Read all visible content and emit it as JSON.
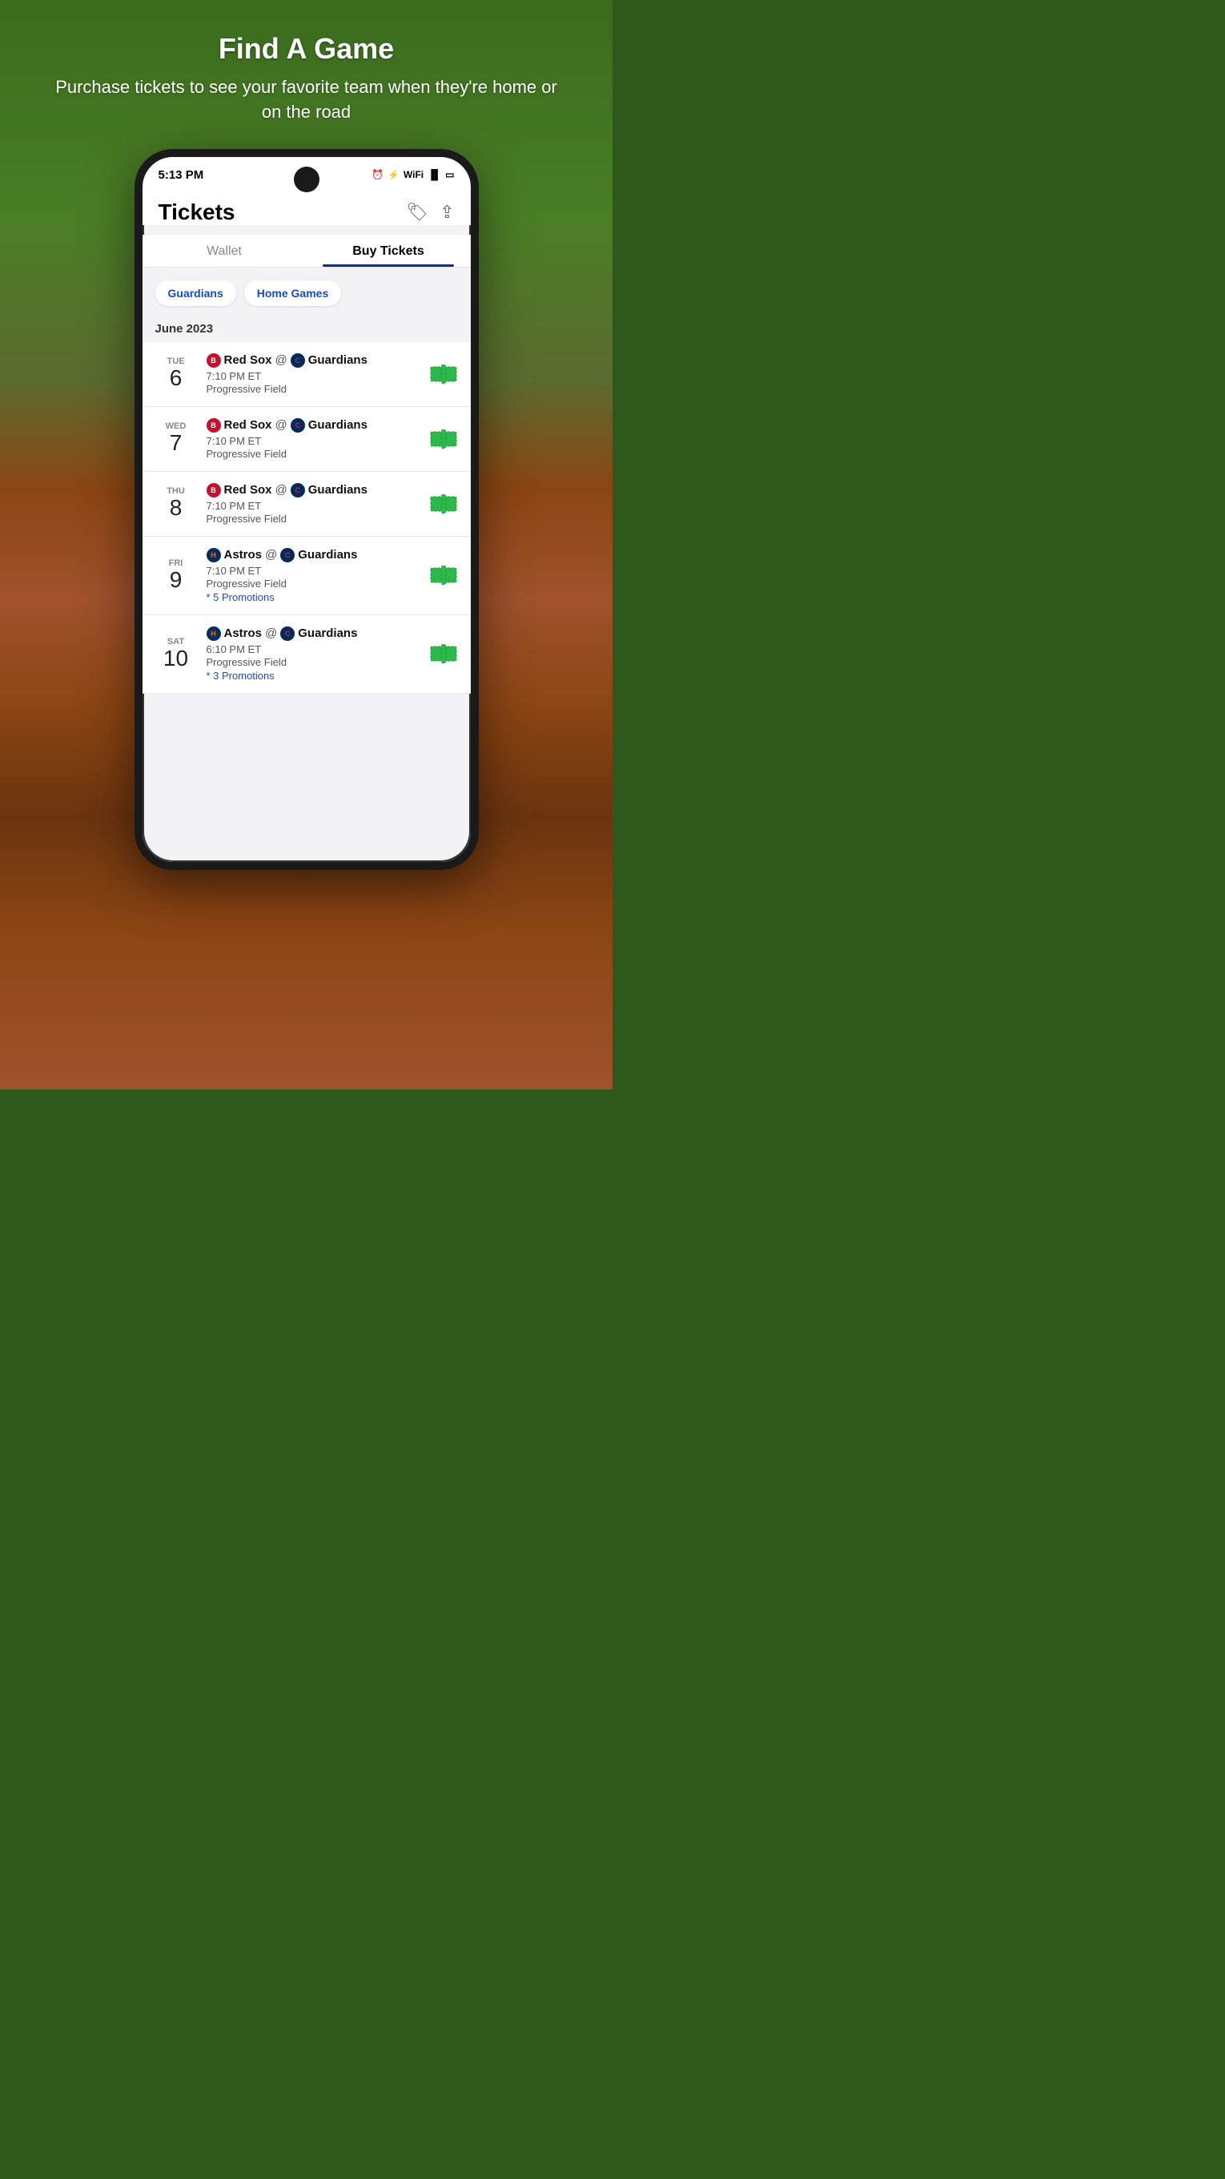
{
  "background": {
    "color": "#3a6b1e"
  },
  "hero": {
    "title": "Find A Game",
    "subtitle": "Purchase tickets to see your favorite team when they're home or on the road"
  },
  "status_bar": {
    "time": "5:13 PM"
  },
  "app": {
    "title": "Tickets",
    "header_icons": {
      "tags_icon": "🏷",
      "share_icon": "↗"
    },
    "tabs": [
      {
        "label": "Wallet",
        "active": false
      },
      {
        "label": "Buy Tickets",
        "active": true
      }
    ],
    "filters": [
      {
        "label": "Guardians"
      },
      {
        "label": "Home Games"
      }
    ],
    "month_section": {
      "label": "June 2023"
    },
    "games": [
      {
        "day_label": "TUE",
        "day_num": "6",
        "away_team": "Red Sox",
        "home_team": "Guardians",
        "time": "7:10 PM ET",
        "venue": "Progressive Field",
        "promotions": null,
        "away_abbr": "B",
        "home_abbr": "C",
        "away_type": "redsox",
        "home_type": "guardians"
      },
      {
        "day_label": "WED",
        "day_num": "7",
        "away_team": "Red Sox",
        "home_team": "Guardians",
        "time": "7:10 PM ET",
        "venue": "Progressive Field",
        "promotions": null,
        "away_abbr": "B",
        "home_abbr": "C",
        "away_type": "redsox",
        "home_type": "guardians"
      },
      {
        "day_label": "THU",
        "day_num": "8",
        "away_team": "Red Sox",
        "home_team": "Guardians",
        "time": "7:10 PM ET",
        "venue": "Progressive Field",
        "promotions": null,
        "away_abbr": "B",
        "home_abbr": "C",
        "away_type": "redsox",
        "home_type": "guardians"
      },
      {
        "day_label": "FRI",
        "day_num": "9",
        "away_team": "Astros",
        "home_team": "Guardians",
        "time": "7:10 PM ET",
        "venue": "Progressive Field",
        "promotions": "* 5 Promotions",
        "away_abbr": "H",
        "home_abbr": "C",
        "away_type": "astros",
        "home_type": "guardians"
      },
      {
        "day_label": "SAT",
        "day_num": "10",
        "away_team": "Astros",
        "home_team": "Guardians",
        "time": "6:10 PM ET",
        "venue": "Progressive Field",
        "promotions": "* 3 Promotions",
        "away_abbr": "H",
        "home_abbr": "C",
        "away_type": "astros",
        "home_type": "guardians"
      }
    ]
  }
}
